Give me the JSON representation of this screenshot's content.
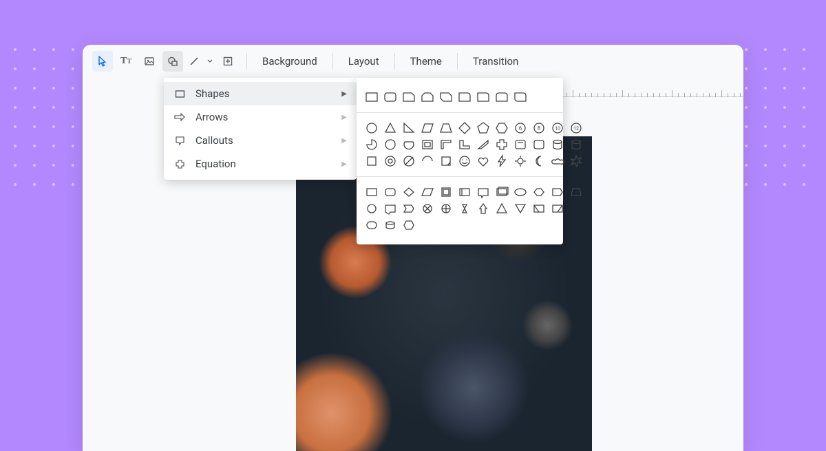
{
  "toolbar": {
    "background": "Background",
    "layout": "Layout",
    "theme": "Theme",
    "transition": "Transition"
  },
  "shape_menu": {
    "shapes": "Shapes",
    "arrows": "Arrows",
    "callouts": "Callouts",
    "equation": "Equation"
  },
  "shape_gallery": {
    "section1": [
      "rectangle",
      "rounded-rect",
      "snip-single",
      "snip-same",
      "snip-diag",
      "snip-round",
      "round-single",
      "round-same",
      "round-diag"
    ],
    "section2_row1": [
      "circle",
      "triangle",
      "right-tri",
      "parallelogram",
      "trapezoid",
      "diamond",
      "pentagon",
      "hexagon",
      "heptagon",
      "octagon",
      "decagon",
      "dodecagon"
    ],
    "section2_row2": [
      "pie",
      "teardrop",
      "chord",
      "frame",
      "half-frame",
      "l-shape",
      "diag-stripe",
      "cross",
      "arc",
      "plaque",
      "can",
      "cylinder"
    ],
    "section2_row3": [
      "square",
      "donut",
      "block-arc",
      "folded",
      "curved",
      "smiley",
      "heart",
      "lightning",
      "sun",
      "moon",
      "cloud",
      "explosion"
    ],
    "section3_row1": [
      "flow-rect",
      "flow-round",
      "flow-rhombus",
      "flow-para",
      "flow-doc",
      "flow-multi",
      "flow-data",
      "flow-io",
      "flow-card",
      "flow-pent",
      "flow-hex",
      "flow-trap"
    ],
    "section3_row2": [
      "flow-circ",
      "flow-merge",
      "flow-db",
      "flow-cross",
      "flow-plus",
      "flow-x",
      "flow-up",
      "flow-tri",
      "flow-down",
      "flow-half1",
      "flow-half2"
    ],
    "section3_row3": [
      "flow-round2",
      "flow-cyl",
      "flow-hex2",
      "flow-blank"
    ]
  }
}
